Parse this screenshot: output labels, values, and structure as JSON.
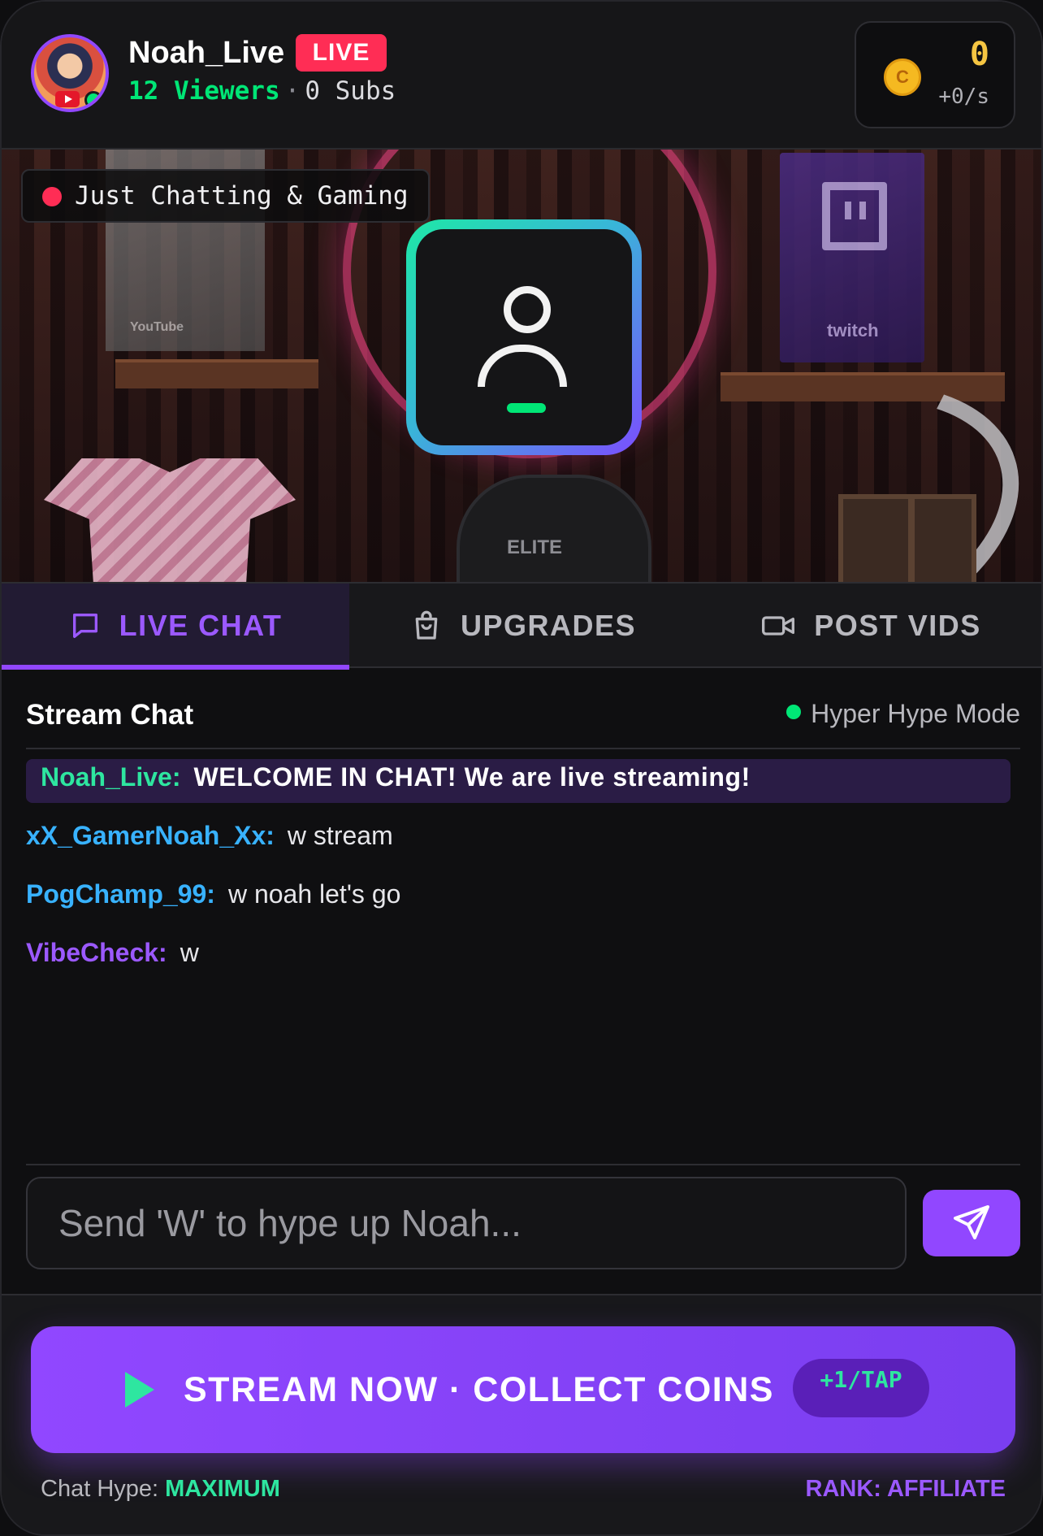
{
  "header": {
    "streamer_name": "Noah_Live",
    "live_badge": "LIVE",
    "viewers": "12 Viewers",
    "separator": "·",
    "subs": "0 Subs",
    "coin_symbol": "C",
    "coin_count": "0",
    "coin_rate": "+0/s"
  },
  "stream": {
    "category": "Just Chatting & Gaming",
    "plaque_youtube_text": "YouTube",
    "plaque_twitch_text": "twitch",
    "chair_text": "ELITE"
  },
  "tabs": [
    {
      "label": "LIVE CHAT",
      "icon": "chat-bubble-icon",
      "active": true
    },
    {
      "label": "UPGRADES",
      "icon": "shopping-bag-icon",
      "active": false
    },
    {
      "label": "POST VIDS",
      "icon": "video-camera-icon",
      "active": false
    }
  ],
  "chat": {
    "title": "Stream Chat",
    "mode": "Hyper Hype Mode",
    "messages": [
      {
        "user": "Noah_Live:",
        "text": "WELCOME IN CHAT! We are live streaming!",
        "color": "#2ee6a0"
      },
      {
        "user": "xX_GamerNoah_Xx:",
        "text": "w stream",
        "color": "#38b2ff"
      },
      {
        "user": "PogChamp_99:",
        "text": "w noah let's go",
        "color": "#38b2ff"
      },
      {
        "user": "VibeCheck:",
        "text": "w",
        "color": "#9b59ff"
      }
    ],
    "input_placeholder": "Send 'W' to hype up Noah..."
  },
  "footer": {
    "stream_button_label": "STREAM NOW · COLLECT COINS",
    "tap_badge": "+1/TAP",
    "chat_hype_label": "Chat Hype:",
    "chat_hype_value": "MAXIMUM",
    "rank": "RANK: AFFILIATE"
  },
  "colors": {
    "accent": "#9147ff",
    "live_red": "#ff2d55",
    "green": "#00e676",
    "coin_gold": "#f5c542"
  }
}
